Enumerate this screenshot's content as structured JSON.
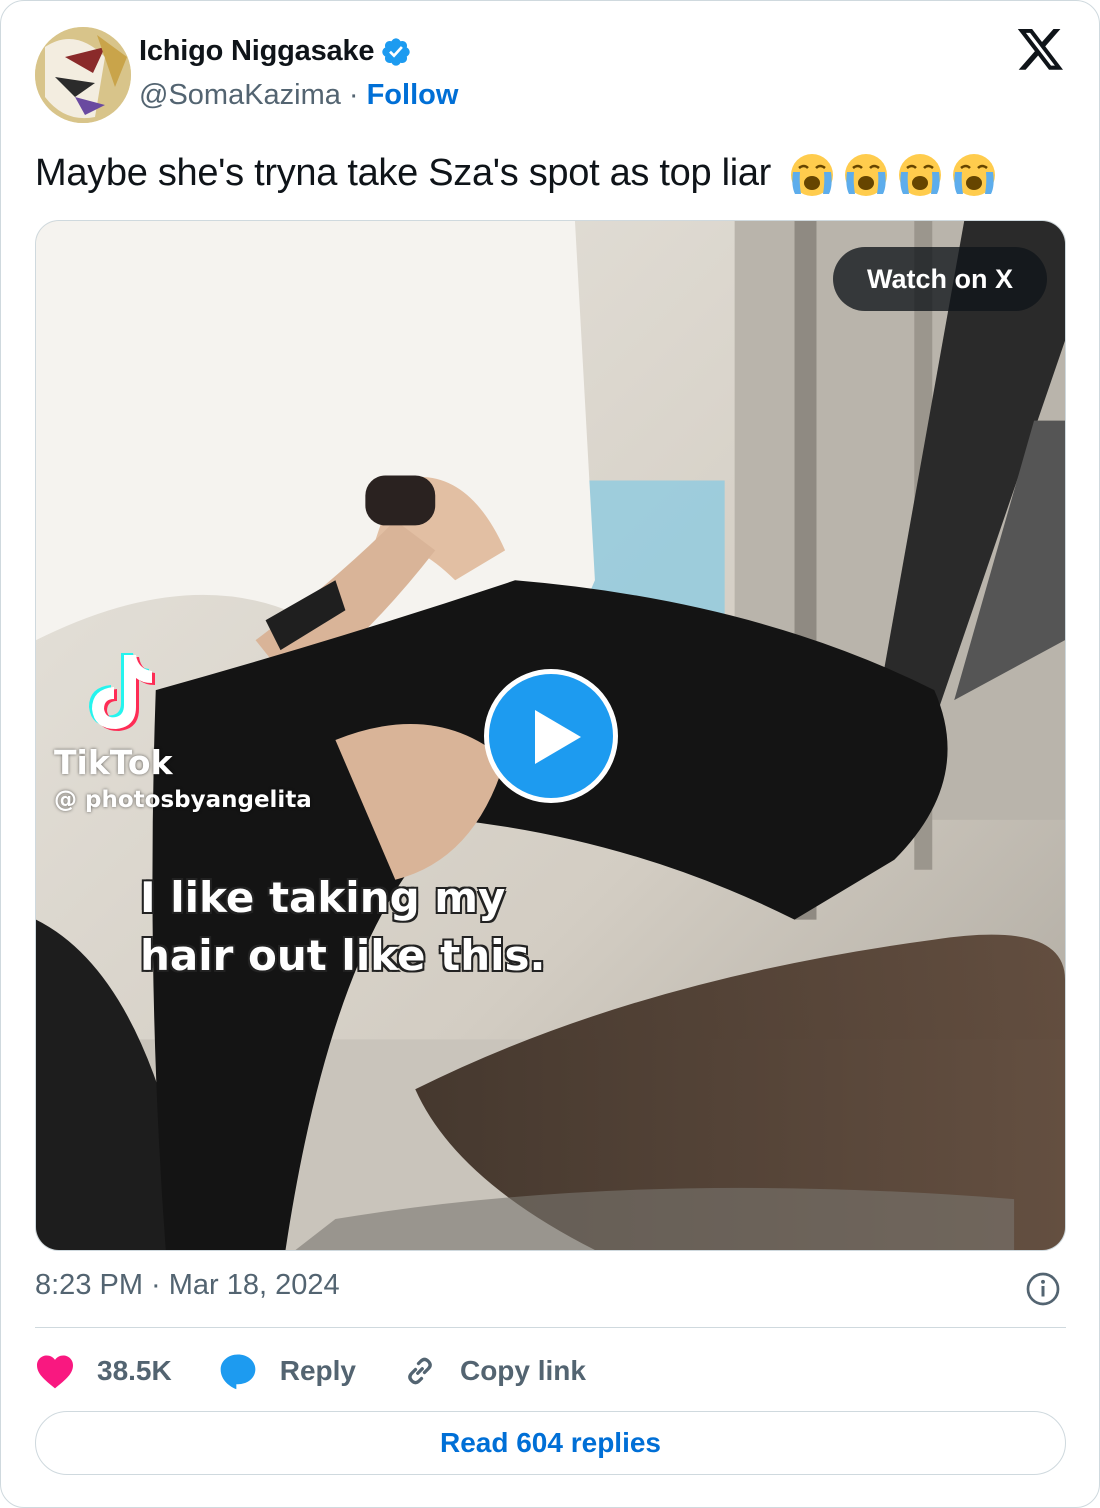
{
  "tweet": {
    "author_name": "Ichigo Niggasake",
    "author_handle": "@SomaKazima",
    "separator": "·",
    "follow_label": "Follow",
    "text": "Maybe she's tryna take Sza's spot as top liar",
    "emoji_count_text": "😭😭😭😭",
    "timestamp": "8:23 PM · Mar 18, 2024"
  },
  "media": {
    "watch_label": "Watch on X",
    "tiktok_brand": "TikTok",
    "tiktok_user": "@ photosbyangelita",
    "caption": "I like taking my\nhair out like this."
  },
  "actions": {
    "likes": "38.5K",
    "reply_label": "Reply",
    "copy_link_label": "Copy link"
  },
  "read_replies_label": "Read 604 replies",
  "colors": {
    "link_blue": "#006fd6",
    "like_pink": "#f91880",
    "reply_blue": "#1d9bf0",
    "muted": "#536471",
    "border": "#cfd9de"
  },
  "icons": [
    "verified-badge-icon",
    "x-logo-icon",
    "loudly-crying-face-icon",
    "play-icon",
    "tiktok-logo-icon",
    "info-icon",
    "heart-icon",
    "reply-bubble-icon",
    "link-icon"
  ]
}
